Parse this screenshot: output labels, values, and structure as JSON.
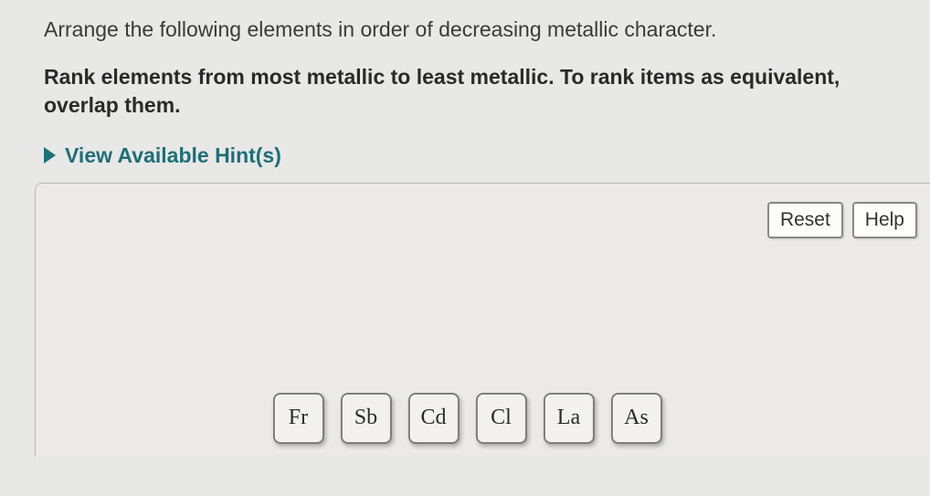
{
  "question": "Arrange the following elements in order of decreasing metallic character.",
  "instruction": "Rank elements from most metallic to least metallic. To rank items as equivalent, overlap them.",
  "hints_label": "View Available Hint(s)",
  "toolbar": {
    "reset_label": "Reset",
    "help_label": "Help"
  },
  "tiles": {
    "t0": "Fr",
    "t1": "Sb",
    "t2": "Cd",
    "t3": "Cl",
    "t4": "La",
    "t5": "As"
  }
}
